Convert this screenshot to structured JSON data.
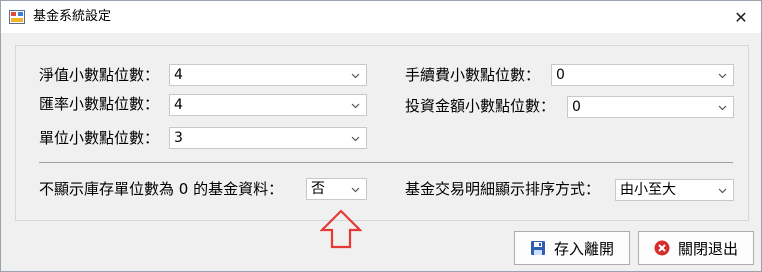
{
  "window": {
    "title": "基金系統設定",
    "close_glyph": "✕"
  },
  "fields": {
    "nav_decimal": {
      "label": "淨值小數點位數：",
      "value": "4"
    },
    "fx_decimal": {
      "label": "匯率小數點位數：",
      "value": "4"
    },
    "unit_decimal": {
      "label": "單位小數點位數：",
      "value": "3"
    },
    "fee_decimal": {
      "label": "手續費小數點位數：",
      "value": "0"
    },
    "amount_decimal": {
      "label": "投資金額小數點位數：",
      "value": "0"
    },
    "hide_zero_units": {
      "label": "不顯示庫存單位數為 0 的基金資料：",
      "value": "否"
    },
    "sort_order": {
      "label": "基金交易明細顯示排序方式：",
      "value": "由小至大"
    }
  },
  "buttons": {
    "save_exit": "存入離開",
    "close_exit": "關閉退出"
  },
  "colors": {
    "accent_arrow": "#e53935",
    "close_icon": "#d32f2f",
    "save_icon": "#2f5fb3"
  },
  "icons": {
    "app": "app-icon",
    "dropdown": "chevron-down-icon",
    "save": "save-icon",
    "close": "close-circle-icon",
    "annotation": "up-arrow-icon"
  }
}
